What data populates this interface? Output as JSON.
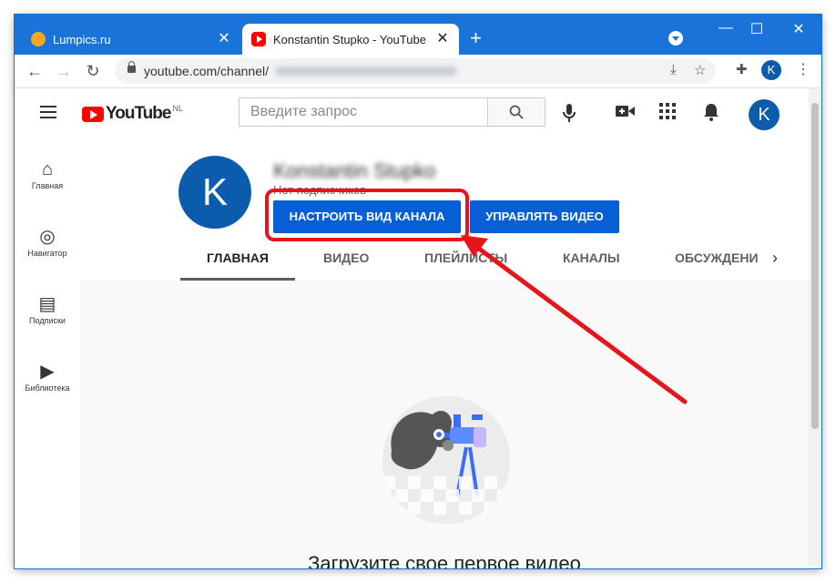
{
  "browser": {
    "tabs": [
      {
        "title": "Lumpics.ru",
        "active": false
      },
      {
        "title": "Konstantin Stupko - YouTube",
        "active": true
      }
    ],
    "new_tab": "+",
    "window_controls": {
      "minimize": "—",
      "maximize": "☐",
      "close": "✕"
    },
    "tab_close": "✕",
    "url": "youtube.com/channel/",
    "profile_initial": "K"
  },
  "youtube": {
    "logo_text": "YouTube",
    "region": "NL",
    "search_placeholder": "Введите запрос",
    "avatar_initial": "K"
  },
  "sidebar": {
    "items": [
      {
        "label": "Главная",
        "icon": "home-icon"
      },
      {
        "label": "Навигатор",
        "icon": "compass-icon"
      },
      {
        "label": "Подписки",
        "icon": "subscriptions-icon"
      },
      {
        "label": "Библиотека",
        "icon": "library-icon"
      }
    ]
  },
  "channel": {
    "avatar_initial": "K",
    "name": "Konstantin Stupko",
    "subscribers": "Нет подписчиков",
    "customize_button": "НАСТРОИТЬ ВИД КАНАЛА",
    "manage_button": "УПРАВЛЯТЬ ВИДЕО",
    "tabs": [
      "ГЛАВНАЯ",
      "ВИДЕО",
      "ПЛЕЙЛИСТЫ",
      "КАНАЛЫ",
      "ОБСУЖДЕНИ"
    ],
    "active_tab": 0,
    "empty_title": "Загрузите свое первое видео"
  },
  "colors": {
    "titlebar": "#1a73d8",
    "button_blue": "#065fd4",
    "highlight_red": "#e8141b"
  }
}
